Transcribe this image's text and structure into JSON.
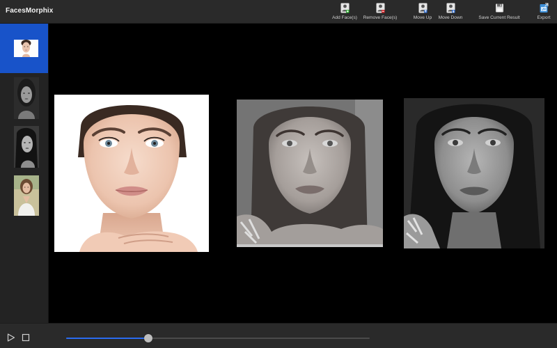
{
  "app": {
    "title": "FacesMorphix"
  },
  "toolbar": {
    "add_faces": "Add Face(s)",
    "remove_faces": "Remove Face(s)",
    "move_up": "Move Up",
    "move_down": "Move Down",
    "save_result": "Save Current Result",
    "export": "Export"
  },
  "icons": {
    "add_faces": "add-person-icon",
    "remove_faces": "remove-person-icon",
    "move_up": "move-up-icon",
    "move_down": "move-down-icon",
    "save_result": "floppy-disk-icon",
    "export": "export-icon",
    "play": "play-icon",
    "stop": "stop-icon"
  },
  "colors": {
    "toolbar_bg": "#2a2a2a",
    "sidebar_bg": "#232323",
    "selection": "#1853c9",
    "slider_fill": "#2a6bf0",
    "workspace_bg": "#000000"
  },
  "sidebar": {
    "thumbnails": [
      {
        "name": "face-thumbnail-1",
        "selected": true,
        "tone": "color"
      },
      {
        "name": "face-thumbnail-2",
        "selected": false,
        "tone": "grayscale"
      },
      {
        "name": "face-thumbnail-3",
        "selected": false,
        "tone": "grayscale"
      },
      {
        "name": "face-thumbnail-4",
        "selected": false,
        "tone": "color"
      }
    ]
  },
  "workspace": {
    "panels": [
      "source-face",
      "morph-result",
      "target-face"
    ]
  },
  "playback": {
    "progress": 0.27
  }
}
